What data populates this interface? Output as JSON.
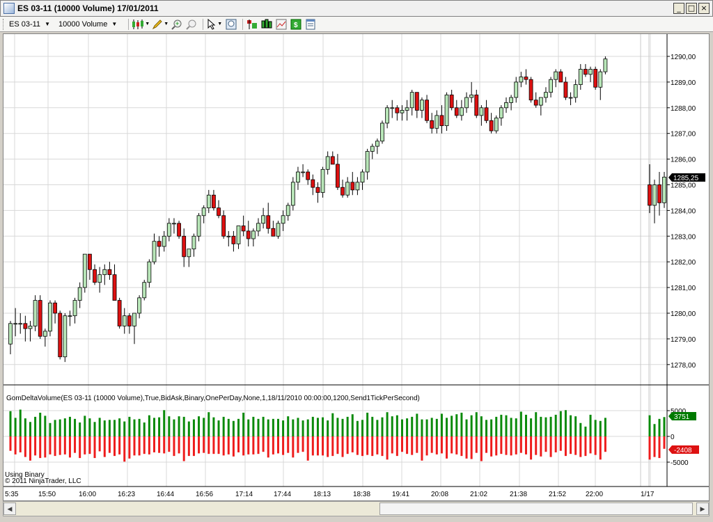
{
  "window": {
    "title": "ES 03-11 (10000 Volume)  17/01/2011",
    "buttons": {
      "minimize": "_",
      "maximize": "□",
      "close": "×"
    }
  },
  "toolbar": {
    "instrument": "ES 03-11",
    "period": "10000 Volume",
    "icons": [
      "candlestick-style-icon",
      "pencil-draw-icon",
      "zoom-in-icon",
      "zoom-out-icon",
      "pointer-icon",
      "zoom-fit-icon",
      "strategies-icon",
      "indicators-icon",
      "chart-data-icon",
      "dollar-icon",
      "properties-icon"
    ]
  },
  "price_panel": {
    "y_ticks": [
      "1290,00",
      "1289,00",
      "1288,00",
      "1287,00",
      "1286,00",
      "1285,00",
      "1284,00",
      "1283,00",
      "1282,00",
      "1281,00",
      "1280,00",
      "1279,00",
      "1278,00"
    ],
    "last_price": "1285,25"
  },
  "indicator_panel": {
    "label": "GomDeltaVolume(ES 03-11 (10000 Volume),True,BidAsk,Binary,OnePerDay,None,1,18/11/2010 00:00:00,1200,Send1TickPerSecond)",
    "y_ticks": [
      "5000",
      "0",
      "-5000"
    ],
    "last_positive": "3751",
    "last_negative": "-2408",
    "footer_mode": "Using Binary",
    "copyright": "© 2011 NinjaTrader, LLC"
  },
  "x_axis": {
    "labels": [
      "5:35",
      "15:50",
      "16:00",
      "16:23",
      "16:44",
      "16:56",
      "17:14",
      "17:44",
      "18:13",
      "18:38",
      "19:41",
      "20:08",
      "21:02",
      "21:38",
      "21:52",
      "22:00",
      "1/17"
    ]
  },
  "colors": {
    "up_body": "#b8e6b8",
    "down_body": "#dd1111",
    "wick": "#000000",
    "delta_pos": "#0a8a0a",
    "delta_neg": "#ee1c1c",
    "last_price_bg": "#000000",
    "pos_badge": "#007a00",
    "neg_badge": "#dd1111"
  },
  "chart_data": {
    "type": "candlestick",
    "ohlc": [
      [
        1278.8,
        1279.7,
        1278.4,
        1279.6
      ],
      [
        1279.6,
        1280.2,
        1279.1,
        1279.6
      ],
      [
        1279.6,
        1280.0,
        1279.2,
        1279.6
      ],
      [
        1279.6,
        1279.9,
        1278.9,
        1279.4
      ],
      [
        1279.4,
        1279.7,
        1278.9,
        1279.5
      ],
      [
        1279.5,
        1280.7,
        1279.3,
        1280.5
      ],
      [
        1280.5,
        1280.7,
        1279.0,
        1279.1
      ],
      [
        1279.1,
        1279.4,
        1278.7,
        1279.3
      ],
      [
        1279.3,
        1280.5,
        1279.1,
        1280.4
      ],
      [
        1280.4,
        1280.5,
        1279.6,
        1280.0
      ],
      [
        1280.0,
        1280.1,
        1278.2,
        1278.3
      ],
      [
        1278.3,
        1280.0,
        1278.1,
        1279.9
      ],
      [
        1279.9,
        1280.1,
        1279.5,
        1279.9
      ],
      [
        1279.9,
        1280.6,
        1279.6,
        1280.5
      ],
      [
        1280.5,
        1281.2,
        1280.2,
        1281.0
      ],
      [
        1281.0,
        1281.8,
        1280.8,
        1282.3
      ],
      [
        1282.3,
        1282.3,
        1281.3,
        1281.7
      ],
      [
        1281.7,
        1281.9,
        1281.1,
        1281.2
      ],
      [
        1281.2,
        1281.8,
        1280.8,
        1281.5
      ],
      [
        1281.5,
        1281.9,
        1281.1,
        1281.7
      ],
      [
        1281.7,
        1282.0,
        1281.3,
        1281.5
      ],
      [
        1281.5,
        1281.9,
        1280.7,
        1280.5
      ],
      [
        1280.5,
        1280.6,
        1279.4,
        1279.5
      ],
      [
        1279.5,
        1280.2,
        1279.2,
        1279.9
      ],
      [
        1279.9,
        1280.0,
        1279.2,
        1279.5
      ],
      [
        1279.5,
        1280.0,
        1278.8,
        1280.0
      ],
      [
        1280.0,
        1280.7,
        1279.8,
        1280.6
      ],
      [
        1280.6,
        1281.3,
        1280.5,
        1281.2
      ],
      [
        1281.2,
        1282.1,
        1281.0,
        1282.0
      ],
      [
        1282.0,
        1283.1,
        1281.9,
        1282.8
      ],
      [
        1282.8,
        1283.0,
        1282.2,
        1282.6
      ],
      [
        1282.6,
        1283.2,
        1282.4,
        1283.0
      ],
      [
        1283.0,
        1283.7,
        1282.8,
        1283.5
      ],
      [
        1283.5,
        1283.7,
        1283.1,
        1283.5
      ],
      [
        1283.5,
        1283.6,
        1282.9,
        1283.0
      ],
      [
        1283.0,
        1283.3,
        1281.8,
        1282.2
      ],
      [
        1282.2,
        1282.4,
        1281.8,
        1282.5
      ],
      [
        1282.5,
        1283.1,
        1282.2,
        1283.0
      ],
      [
        1283.0,
        1283.9,
        1282.8,
        1283.8
      ],
      [
        1283.8,
        1284.2,
        1283.5,
        1284.1
      ],
      [
        1284.1,
        1284.8,
        1283.9,
        1284.6
      ],
      [
        1284.6,
        1284.8,
        1284.0,
        1284.1
      ],
      [
        1284.1,
        1284.4,
        1283.7,
        1283.8
      ],
      [
        1283.8,
        1284.0,
        1282.9,
        1283.0
      ],
      [
        1283.0,
        1283.2,
        1282.6,
        1283.0
      ],
      [
        1283.0,
        1283.2,
        1282.4,
        1282.7
      ],
      [
        1282.7,
        1283.1,
        1282.5,
        1283.4
      ],
      [
        1283.4,
        1283.8,
        1283.0,
        1283.2
      ],
      [
        1283.2,
        1283.6,
        1282.6,
        1282.9
      ],
      [
        1282.9,
        1283.3,
        1282.6,
        1283.2
      ],
      [
        1283.2,
        1283.7,
        1283.0,
        1283.5
      ],
      [
        1283.5,
        1284.1,
        1283.3,
        1283.8
      ],
      [
        1283.8,
        1284.3,
        1283.1,
        1283.3
      ],
      [
        1283.3,
        1283.6,
        1283.0,
        1283.0
      ],
      [
        1283.0,
        1283.6,
        1282.9,
        1283.5
      ],
      [
        1283.5,
        1284.0,
        1283.2,
        1283.8
      ],
      [
        1283.8,
        1284.3,
        1283.6,
        1284.2
      ],
      [
        1284.2,
        1285.3,
        1284.0,
        1285.1
      ],
      [
        1285.1,
        1285.7,
        1284.8,
        1285.5
      ],
      [
        1285.5,
        1285.8,
        1285.3,
        1285.5
      ],
      [
        1285.5,
        1285.6,
        1285.0,
        1285.2
      ],
      [
        1285.2,
        1285.4,
        1284.6,
        1284.9
      ],
      [
        1284.9,
        1285.1,
        1284.3,
        1284.7
      ],
      [
        1284.7,
        1285.7,
        1284.5,
        1285.6
      ],
      [
        1285.6,
        1286.3,
        1285.4,
        1286.1
      ],
      [
        1286.1,
        1286.3,
        1285.8,
        1285.8
      ],
      [
        1285.8,
        1286.2,
        1284.8,
        1284.9
      ],
      [
        1284.9,
        1285.2,
        1284.5,
        1284.6
      ],
      [
        1284.6,
        1285.3,
        1284.5,
        1285.1
      ],
      [
        1285.1,
        1285.5,
        1284.6,
        1284.8
      ],
      [
        1284.8,
        1285.3,
        1284.6,
        1285.1
      ],
      [
        1285.1,
        1285.6,
        1284.8,
        1285.5
      ],
      [
        1285.5,
        1286.4,
        1285.2,
        1286.3
      ],
      [
        1286.3,
        1286.6,
        1286.0,
        1286.5
      ],
      [
        1286.5,
        1286.8,
        1286.2,
        1286.7
      ],
      [
        1286.7,
        1287.5,
        1286.6,
        1287.4
      ],
      [
        1287.4,
        1288.1,
        1287.2,
        1288.0
      ],
      [
        1288.0,
        1288.3,
        1287.6,
        1288.0
      ],
      [
        1288.0,
        1288.1,
        1287.5,
        1287.8
      ],
      [
        1287.8,
        1288.1,
        1287.5,
        1287.9
      ],
      [
        1287.9,
        1288.3,
        1287.5,
        1288.0
      ],
      [
        1288.0,
        1288.7,
        1287.7,
        1288.6
      ],
      [
        1288.6,
        1288.6,
        1287.6,
        1287.9
      ],
      [
        1287.9,
        1288.4,
        1287.6,
        1288.3
      ],
      [
        1288.3,
        1288.5,
        1287.4,
        1287.5
      ],
      [
        1287.5,
        1287.8,
        1287.0,
        1287.2
      ],
      [
        1287.2,
        1287.9,
        1287.0,
        1287.7
      ],
      [
        1287.7,
        1288.1,
        1287.0,
        1287.3
      ],
      [
        1287.3,
        1288.6,
        1287.1,
        1288.5
      ],
      [
        1288.5,
        1288.7,
        1287.9,
        1288.0
      ],
      [
        1288.0,
        1288.3,
        1287.6,
        1287.7
      ],
      [
        1287.7,
        1288.3,
        1287.5,
        1288.0
      ],
      [
        1288.0,
        1288.6,
        1287.8,
        1288.4
      ],
      [
        1288.4,
        1289.0,
        1288.2,
        1288.5
      ],
      [
        1288.5,
        1288.7,
        1287.6,
        1287.7
      ],
      [
        1287.7,
        1288.1,
        1287.3,
        1288.0
      ],
      [
        1288.0,
        1288.3,
        1287.4,
        1287.5
      ],
      [
        1287.5,
        1287.8,
        1287.0,
        1287.1
      ],
      [
        1287.1,
        1287.7,
        1287.0,
        1287.6
      ],
      [
        1287.6,
        1288.1,
        1287.3,
        1288.0
      ],
      [
        1288.0,
        1288.4,
        1287.8,
        1288.2
      ],
      [
        1288.2,
        1288.5,
        1287.9,
        1288.4
      ],
      [
        1288.4,
        1289.2,
        1288.2,
        1289.0
      ],
      [
        1289.0,
        1289.4,
        1288.8,
        1289.2
      ],
      [
        1289.2,
        1289.5,
        1288.9,
        1289.1
      ],
      [
        1289.1,
        1289.2,
        1288.2,
        1288.3
      ],
      [
        1288.3,
        1288.6,
        1288.0,
        1288.1
      ],
      [
        1288.1,
        1288.4,
        1287.7,
        1288.4
      ],
      [
        1288.4,
        1288.8,
        1288.2,
        1288.6
      ],
      [
        1288.6,
        1289.2,
        1288.4,
        1289.1
      ],
      [
        1289.1,
        1289.5,
        1288.8,
        1289.4
      ],
      [
        1289.4,
        1289.5,
        1289.0,
        1289.0
      ],
      [
        1289.0,
        1289.2,
        1288.3,
        1288.4
      ],
      [
        1288.4,
        1288.6,
        1288.1,
        1288.4
      ],
      [
        1288.4,
        1289.1,
        1288.2,
        1288.9
      ],
      [
        1288.9,
        1289.7,
        1288.7,
        1289.5
      ],
      [
        1289.5,
        1289.7,
        1289.2,
        1289.3
      ],
      [
        1289.3,
        1289.6,
        1289.0,
        1289.5
      ],
      [
        1289.5,
        1289.6,
        1288.7,
        1288.8
      ],
      [
        1288.8,
        1289.5,
        1288.3,
        1289.4
      ],
      [
        1289.4,
        1290.0,
        1289.3,
        1289.9
      ],
      [
        1285.0,
        1285.8,
        1283.9,
        1284.2
      ],
      [
        1284.2,
        1285.2,
        1283.5,
        1285.0
      ],
      [
        1285.0,
        1285.5,
        1283.8,
        1284.3
      ],
      [
        1284.3,
        1285.5,
        1284.1,
        1285.3
      ]
    ],
    "delta_pos": [
      4900,
      3600,
      5200,
      3500,
      2800,
      3800,
      4600,
      4000,
      2600,
      3200,
      3300,
      3500,
      3800,
      3400,
      2700,
      4000,
      3500,
      2800,
      3600,
      3100,
      3200,
      3200,
      3500,
      2900,
      3800,
      3300,
      3400,
      2700,
      4100,
      3600,
      3700,
      5100,
      3900,
      3300,
      3900,
      3800,
      2900,
      3300,
      3900,
      3600,
      4700,
      3700,
      3100,
      3800,
      3400,
      3000,
      3400,
      4600,
      3300,
      3800,
      3400,
      3800,
      3300,
      3400,
      3400,
      3100,
      3900,
      3300,
      3600,
      3100,
      3300,
      3800,
      3600,
      3700,
      3100,
      4500,
      3600,
      3400,
      3800,
      4300,
      3000,
      3200,
      4600,
      3800,
      3200,
      3700,
      4700,
      3900,
      4100,
      3300,
      3500,
      3800,
      4400,
      3300,
      3300,
      3600,
      3400,
      4400,
      3600,
      4000,
      4300,
      4600,
      3300,
      4100,
      4700,
      3900,
      3200,
      3300,
      3800,
      4200,
      4100,
      3600,
      3500,
      4800,
      4200,
      3500,
      4700,
      3800,
      3700,
      3800,
      4200,
      4900,
      5100,
      4100,
      3900,
      2600,
      1900,
      4200,
      3200,
      3000,
      3600,
      4100,
      2400,
      3400,
      3751
    ],
    "delta_neg": [
      2800,
      3500,
      3100,
      4000,
      4700,
      3700,
      4200,
      4100,
      3500,
      3800,
      3600,
      3500,
      4100,
      3200,
      4200,
      3500,
      3400,
      4200,
      2900,
      4000,
      3200,
      3800,
      3500,
      4900,
      4300,
      3700,
      3700,
      3400,
      3500,
      3100,
      3200,
      3300,
      3000,
      3800,
      3300,
      4800,
      3800,
      3800,
      3300,
      3200,
      3400,
      3400,
      3400,
      3700,
      3500,
      3900,
      3100,
      3700,
      3500,
      3500,
      3400,
      3000,
      4100,
      3500,
      3300,
      3600,
      3200,
      4100,
      3200,
      3000,
      4700,
      3700,
      3700,
      3700,
      4000,
      3800,
      3400,
      4000,
      3400,
      3100,
      3600,
      3800,
      3600,
      3800,
      3500,
      3800,
      4500,
      3300,
      3800,
      3000,
      3400,
      3600,
      3200,
      4700,
      3700,
      3200,
      3500,
      3300,
      4300,
      3300,
      3500,
      3800,
      4300,
      4400,
      3200,
      4800,
      3200,
      3900,
      3700,
      3400,
      3600,
      3700,
      3500,
      3200,
      3500,
      4500,
      3600,
      3900,
      3000,
      4000,
      3100,
      2800,
      3800,
      3400,
      3600,
      4000,
      3800,
      3300,
      3600,
      4500,
      3000,
      4500,
      4000,
      4200,
      2408
    ]
  }
}
